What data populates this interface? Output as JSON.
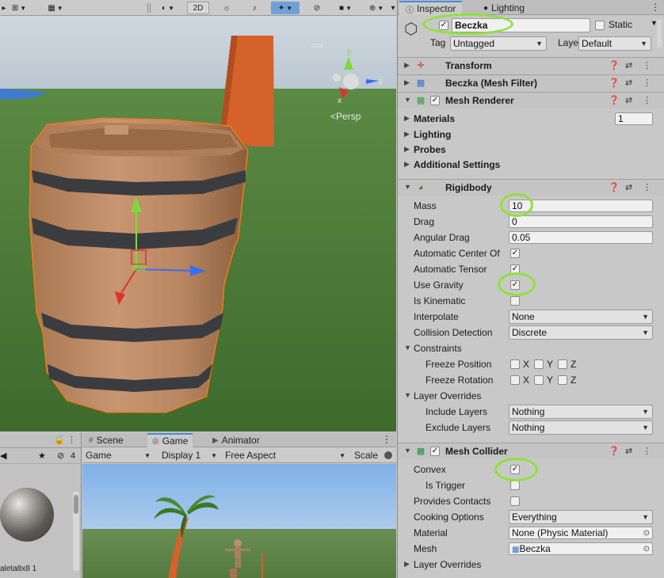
{
  "scene_toolbar": {
    "two_d": "2D",
    "icons": [
      "hand-tool-icon",
      "grid-snap-icon",
      "grid-icon",
      "shading-icon",
      "audio-icon",
      "effects-icon",
      "visibility-icon",
      "camera-icon",
      "gizmos-icon"
    ]
  },
  "scene": {
    "persp_label": "Persp",
    "axis_y": "y",
    "axis_z": "z",
    "axis_x": "x"
  },
  "project": {
    "count": "4",
    "file_label": "aleta8x8 1"
  },
  "game": {
    "tabs": [
      {
        "label": "Scene"
      },
      {
        "label": "Game"
      },
      {
        "label": "Animator"
      }
    ],
    "display_mode": "Game",
    "display": "Display 1",
    "aspect": "Free Aspect",
    "scale_label": "Scale"
  },
  "inspector": {
    "tabs": [
      {
        "label": "Inspector"
      },
      {
        "label": "Lighting"
      }
    ],
    "object": {
      "name": "Beczka",
      "active": true,
      "static_label": "Static",
      "tag_label": "Tag",
      "tag": "Untagged",
      "layer_label": "Layer",
      "layer": "Default"
    },
    "components": {
      "transform": "Transform",
      "mesh_filter": "Beczka (Mesh Filter)",
      "mesh_renderer": "Mesh Renderer",
      "mesh_renderer_enabled": true,
      "rigidbody": "Rigidbody",
      "mesh_collider": "Mesh Collider",
      "mesh_collider_enabled": true
    },
    "mesh_renderer": {
      "materials_label": "Materials",
      "materials_count": "1",
      "lighting_label": "Lighting",
      "probes_label": "Probes",
      "additional_label": "Additional Settings"
    },
    "rigidbody": {
      "mass_label": "Mass",
      "mass": "10",
      "drag_label": "Drag",
      "drag": "0",
      "angular_drag_label": "Angular Drag",
      "angular_drag": "0.05",
      "auto_center_label": "Automatic Center Of",
      "auto_center": true,
      "auto_tensor_label": "Automatic Tensor",
      "auto_tensor": true,
      "use_gravity_label": "Use Gravity",
      "use_gravity": true,
      "is_kinematic_label": "Is Kinematic",
      "is_kinematic": false,
      "interpolate_label": "Interpolate",
      "interpolate": "None",
      "collision_detection_label": "Collision Detection",
      "collision_detection": "Discrete",
      "constraints_label": "Constraints",
      "freeze_position_label": "Freeze Position",
      "freeze_rotation_label": "Freeze Rotation",
      "axis_x": "X",
      "axis_y": "Y",
      "axis_z": "Z",
      "layer_overrides_label": "Layer Overrides",
      "include_layers_label": "Include Layers",
      "include_layers": "Nothing",
      "exclude_layers_label": "Exclude Layers",
      "exclude_layers": "Nothing"
    },
    "mesh_collider": {
      "convex_label": "Convex",
      "convex": true,
      "is_trigger_label": "Is Trigger",
      "is_trigger": false,
      "provides_contacts_label": "Provides Contacts",
      "provides_contacts": false,
      "cooking_options_label": "Cooking Options",
      "cooking_options": "Everything",
      "material_label": "Material",
      "material": "None (Physic Material)",
      "mesh_label": "Mesh",
      "mesh": "Beczka",
      "layer_overrides_label": "Layer Overrides"
    }
  },
  "colors": {
    "highlight": "#8fe23a",
    "selection_outline": "#f07a1e",
    "tab_accent": "#4a8ad8"
  }
}
